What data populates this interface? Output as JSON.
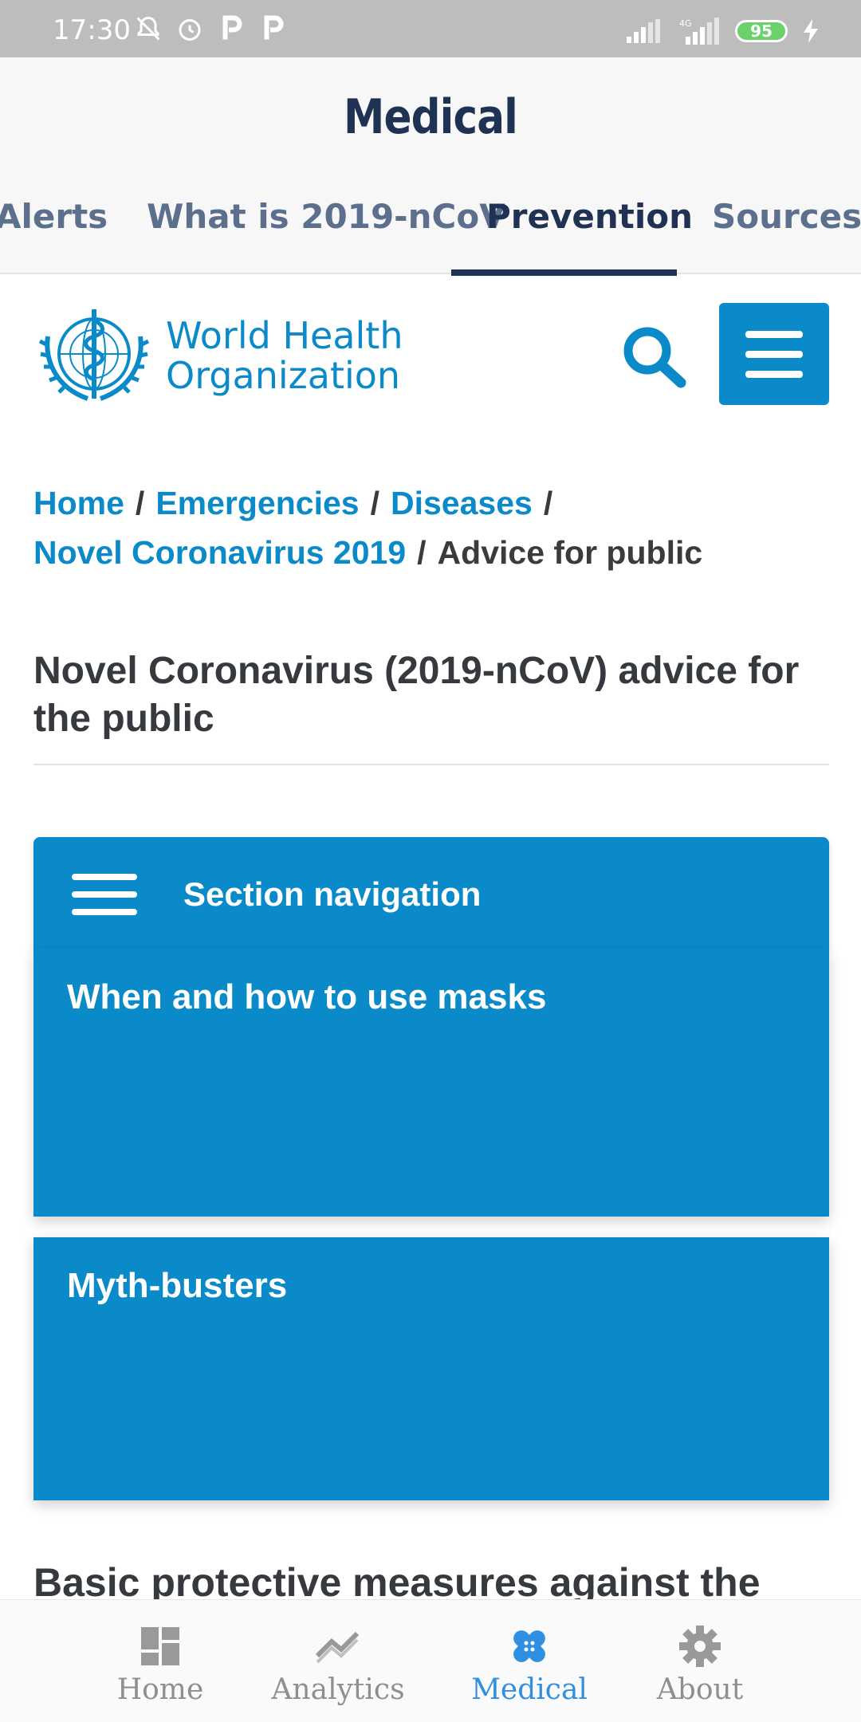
{
  "status_bar": {
    "time": "17:30",
    "battery": "95",
    "network": "4G"
  },
  "header": {
    "title": "Medical",
    "tabs": [
      {
        "label": "Alerts"
      },
      {
        "label": "What is 2019-nCoV"
      },
      {
        "label": "Prevention",
        "active": true
      },
      {
        "label": "Sources"
      }
    ]
  },
  "who": {
    "line1": "World Health",
    "line2": "Organization",
    "accent": "#0b8ac9"
  },
  "breadcrumb": {
    "items": [
      "Home",
      "Emergencies",
      "Diseases",
      "Novel Coronavirus 2019"
    ],
    "current": "Advice for public",
    "separator": "/"
  },
  "page": {
    "title": "Novel Coronavirus (2019-nCoV) advice for the public",
    "section_nav_label": "Section navigation",
    "cards": [
      "When and how to use masks",
      "Myth-busters"
    ],
    "next_heading": "Basic protective measures against the"
  },
  "bottom_nav": {
    "items": [
      {
        "label": "Home",
        "icon": "dashboard-icon"
      },
      {
        "label": "Analytics",
        "icon": "trending-icon"
      },
      {
        "label": "Medical",
        "icon": "bandage-icon",
        "active": true
      },
      {
        "label": "About",
        "icon": "gear-icon"
      }
    ],
    "active_color": "#2f8fe0",
    "inactive_color": "#8f8f8f"
  }
}
